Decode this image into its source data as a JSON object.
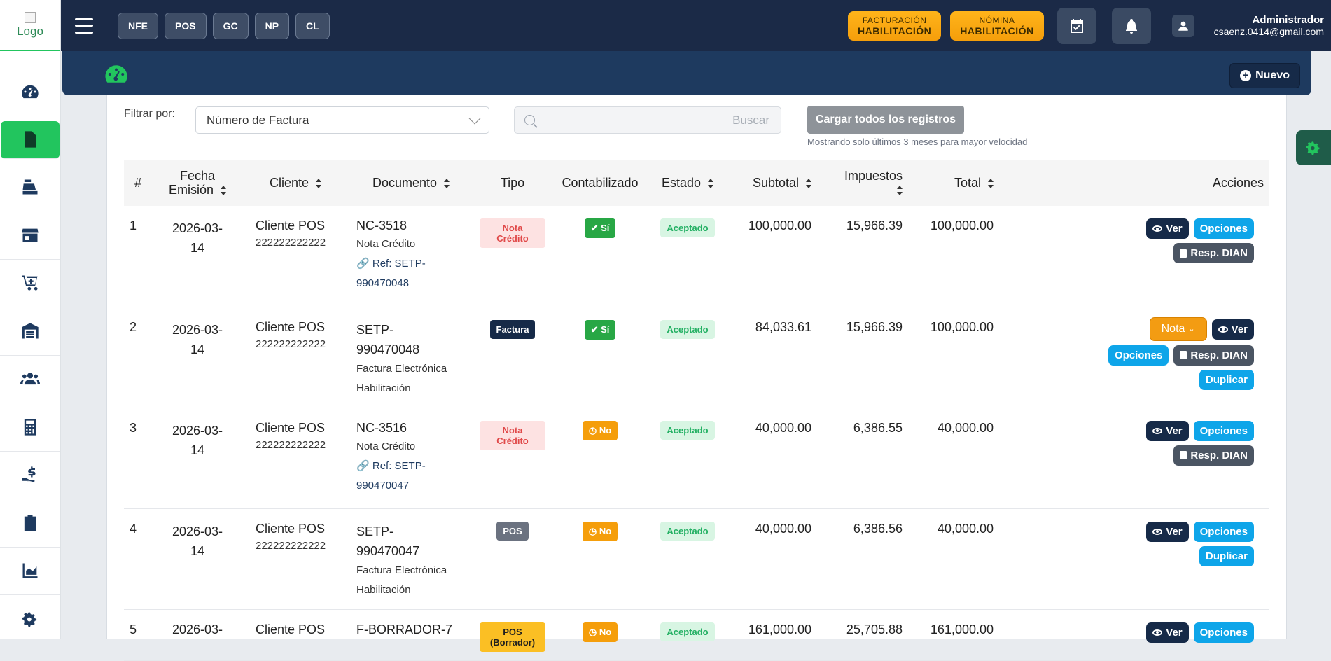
{
  "logo": {
    "alt": "Logo"
  },
  "topbar": {
    "quick": [
      "NFE",
      "POS",
      "GC",
      "NP",
      "CL"
    ],
    "facturacion": {
      "small": "FACTURACIÓN",
      "big": "HABILITACIÓN"
    },
    "nomina": {
      "small": "NÓMINA",
      "big": "HABILITACIÓN"
    },
    "user": {
      "name": "Administrador",
      "email": "csaenz.0414@gmail.com"
    }
  },
  "header": {
    "new_label": "Nuevo"
  },
  "filters": {
    "label": "Filtrar por:",
    "select_value": "Número de Factura",
    "search_placeholder": "Buscar",
    "load_all_label": "Cargar todos los registros",
    "hint": "Mostrando solo últimos 3 meses para mayor velocidad"
  },
  "table": {
    "headers": {
      "num": "#",
      "fecha1": "Fecha",
      "fecha2": "Emisión",
      "cliente": "Cliente",
      "documento": "Documento",
      "tipo": "Tipo",
      "contabilizado": "Contabilizado",
      "estado": "Estado",
      "subtotal": "Subtotal",
      "impuestos": "Impuestos",
      "total": "Total",
      "acciones": "Acciones"
    },
    "rows": [
      {
        "n": "1",
        "date1": "2026-03-",
        "date2": "14",
        "client": "Cliente POS",
        "nit": "222222222222",
        "doc": "NC-3518",
        "doc2": "",
        "sub": "Nota Crédito",
        "ref1": "Ref: SETP-",
        "ref2": "990470048",
        "tipo": "Nota Crédito",
        "cont": "Sí",
        "estado": "Aceptado",
        "subtotal": "100,000.00",
        "impuestos": "15,966.39",
        "total": "100,000.00"
      },
      {
        "n": "2",
        "date1": "2026-03-",
        "date2": "14",
        "client": "Cliente POS",
        "nit": "222222222222",
        "doc": "SETP-",
        "doc2": "990470048",
        "sub": "Factura Electrónica",
        "sub2": "Habilitación",
        "tipo": "Factura",
        "cont": "Sí",
        "estado": "Aceptado",
        "subtotal": "84,033.61",
        "impuestos": "15,966.39",
        "total": "100,000.00"
      },
      {
        "n": "3",
        "date1": "2026-03-",
        "date2": "14",
        "client": "Cliente POS",
        "nit": "222222222222",
        "doc": "NC-3516",
        "doc2": "",
        "sub": "Nota Crédito",
        "ref1": "Ref: SETP-",
        "ref2": "990470047",
        "tipo": "Nota Crédito",
        "cont": "No",
        "estado": "Aceptado",
        "subtotal": "40,000.00",
        "impuestos": "6,386.55",
        "total": "40,000.00"
      },
      {
        "n": "4",
        "date1": "2026-03-",
        "date2": "14",
        "client": "Cliente POS",
        "nit": "222222222222",
        "doc": "SETP-",
        "doc2": "990470047",
        "sub": "Factura Electrónica",
        "sub2": "Habilitación",
        "tipo": "POS",
        "cont": "No",
        "estado": "Aceptado",
        "subtotal": "40,000.00",
        "impuestos": "6,386.56",
        "total": "40,000.00"
      },
      {
        "n": "5",
        "date1": "2026-03-",
        "date2": "",
        "client": "Cliente POS",
        "nit": "",
        "doc": "F-BORRADOR-7",
        "doc2": "",
        "tipo": "POS (Borrador)",
        "cont": "No",
        "estado": "Aceptado",
        "subtotal": "161,000.00",
        "impuestos": "25,705.88",
        "total": "161,000.00"
      }
    ],
    "actions": {
      "ver": "Ver",
      "opciones": "Opciones",
      "resp": "Resp. DIAN",
      "duplicar": "Duplicar",
      "nota": "Nota"
    }
  }
}
